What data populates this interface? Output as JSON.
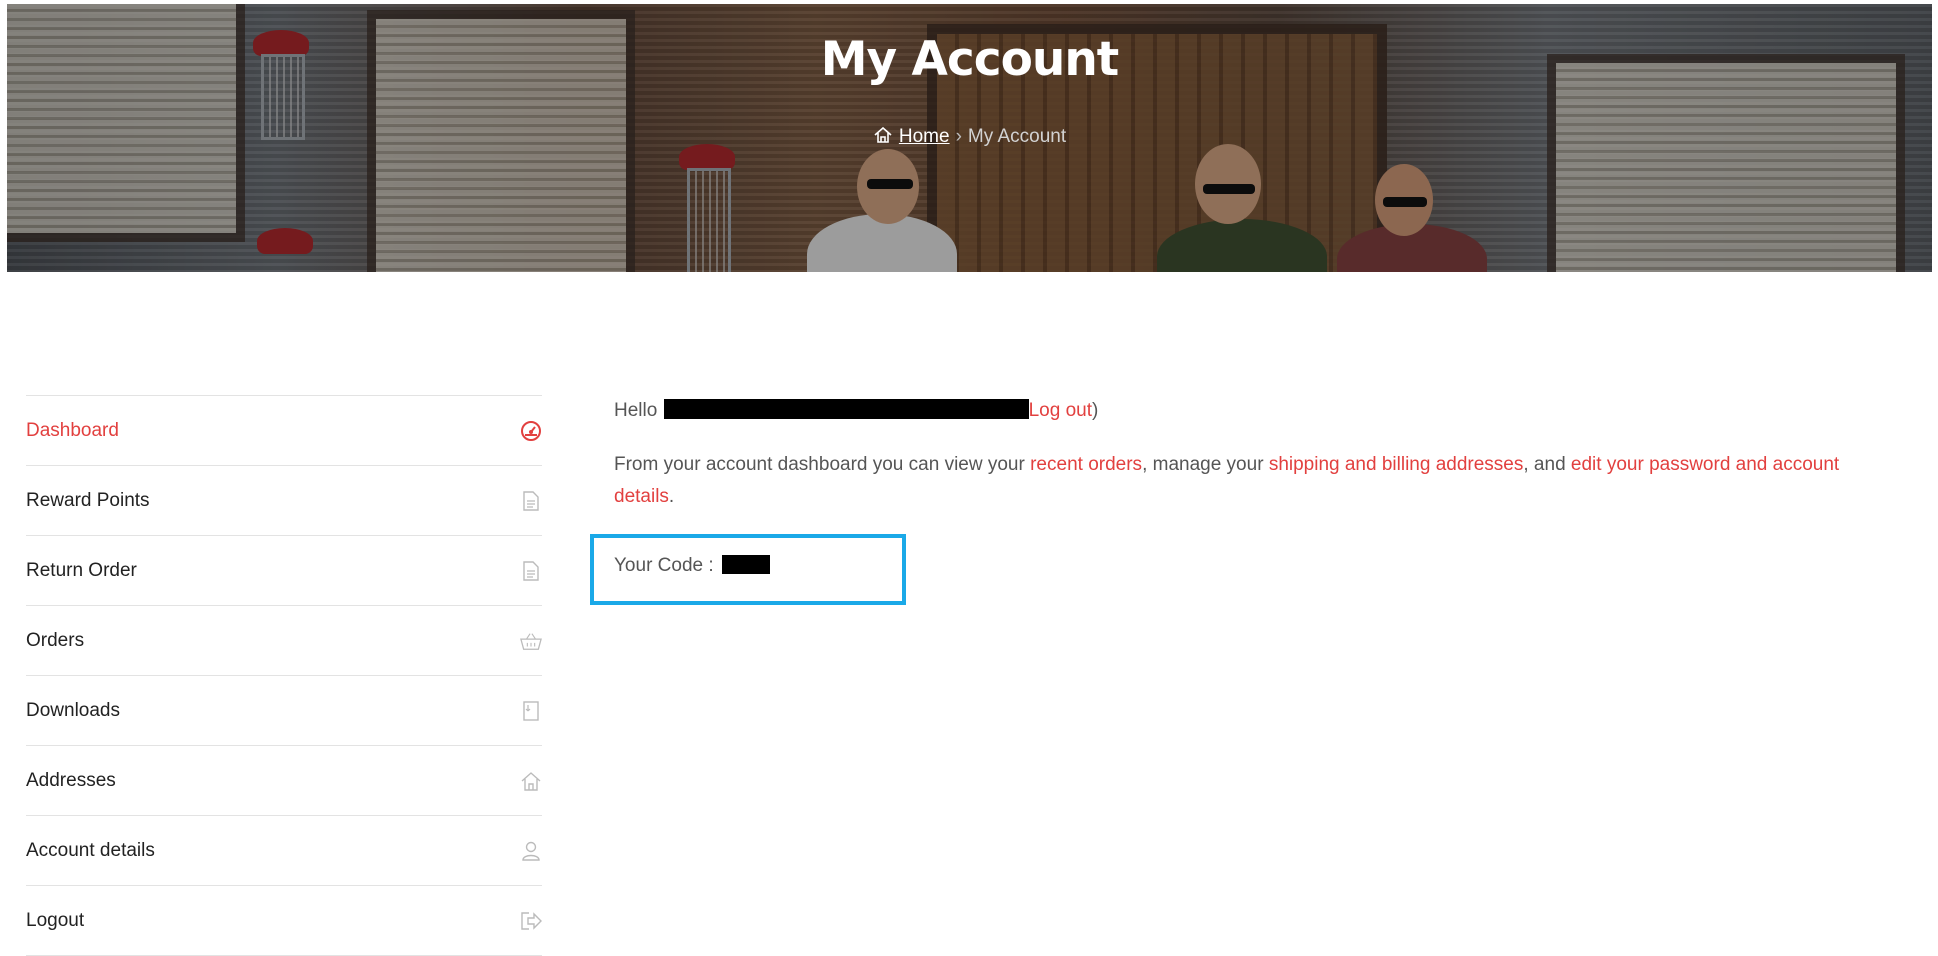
{
  "hero": {
    "title": "My Account",
    "breadcrumb": {
      "home_label": "Home",
      "separator": "›",
      "current": "My Account"
    }
  },
  "sidebar": {
    "items": [
      {
        "label": "Dashboard",
        "icon": "dashboard-gauge-icon",
        "active": true
      },
      {
        "label": "Reward Points",
        "icon": "document-icon",
        "active": false
      },
      {
        "label": "Return Order",
        "icon": "document-icon",
        "active": false
      },
      {
        "label": "Orders",
        "icon": "basket-icon",
        "active": false
      },
      {
        "label": "Downloads",
        "icon": "download-file-icon",
        "active": false
      },
      {
        "label": "Addresses",
        "icon": "home-icon",
        "active": false
      },
      {
        "label": "Account details",
        "icon": "user-icon",
        "active": false
      },
      {
        "label": "Logout",
        "icon": "logout-icon",
        "active": false
      }
    ]
  },
  "main": {
    "hello_prefix": "Hello",
    "logout_link": "Log out",
    "hello_suffix": ")",
    "intro_part1": "From your account dashboard you can view your ",
    "recent_orders_link": "recent orders",
    "intro_part2": ", manage your ",
    "addresses_link": "shipping and billing addresses",
    "intro_part3": ", and ",
    "account_link": "edit your password and account details",
    "intro_end": ".",
    "code_label": "Your Code :"
  },
  "colors": {
    "accent": "#e2403f",
    "highlight_border": "#1aa9e8",
    "text": "#555555",
    "nav_text": "#222222"
  }
}
